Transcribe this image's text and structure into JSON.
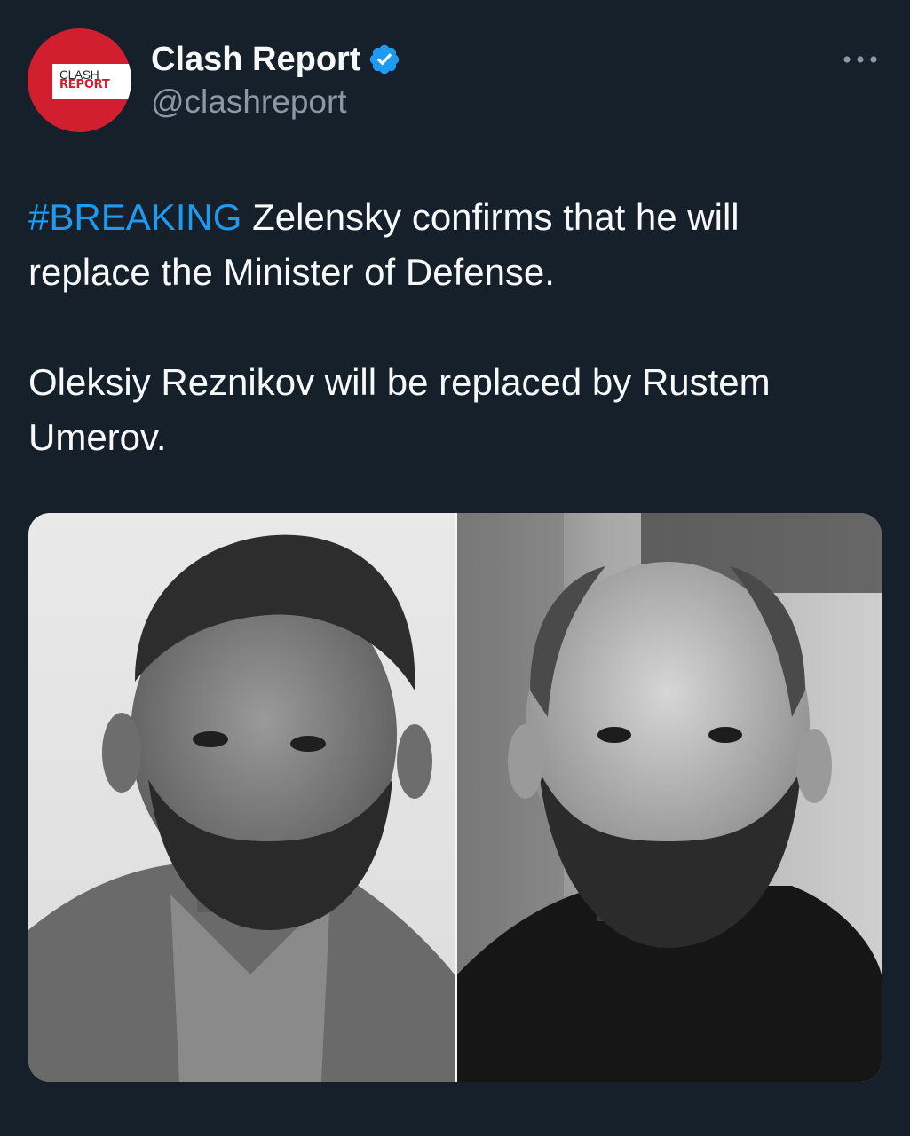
{
  "author": {
    "display_name": "Clash Report",
    "handle": "@clashreport",
    "verified": true,
    "avatar": {
      "logo_line1": "CLASH",
      "logo_line2": "REPORT",
      "brand_color": "#d11f30"
    }
  },
  "tweet": {
    "hashtag": "#BREAKING",
    "text_part1": " Zelensky confirms that he will replace the Minister of Defense.",
    "paragraph2": "Oleksiy Reznikov will be replaced by Rustem Umerov."
  },
  "media": {
    "type": "photo",
    "description_icon": "image-icon"
  },
  "colors": {
    "background": "#15202b",
    "text": "#f7f9f9",
    "secondary_text": "#8b98a5",
    "link": "#1d9bf0",
    "verified_badge": "#1d9bf0"
  }
}
